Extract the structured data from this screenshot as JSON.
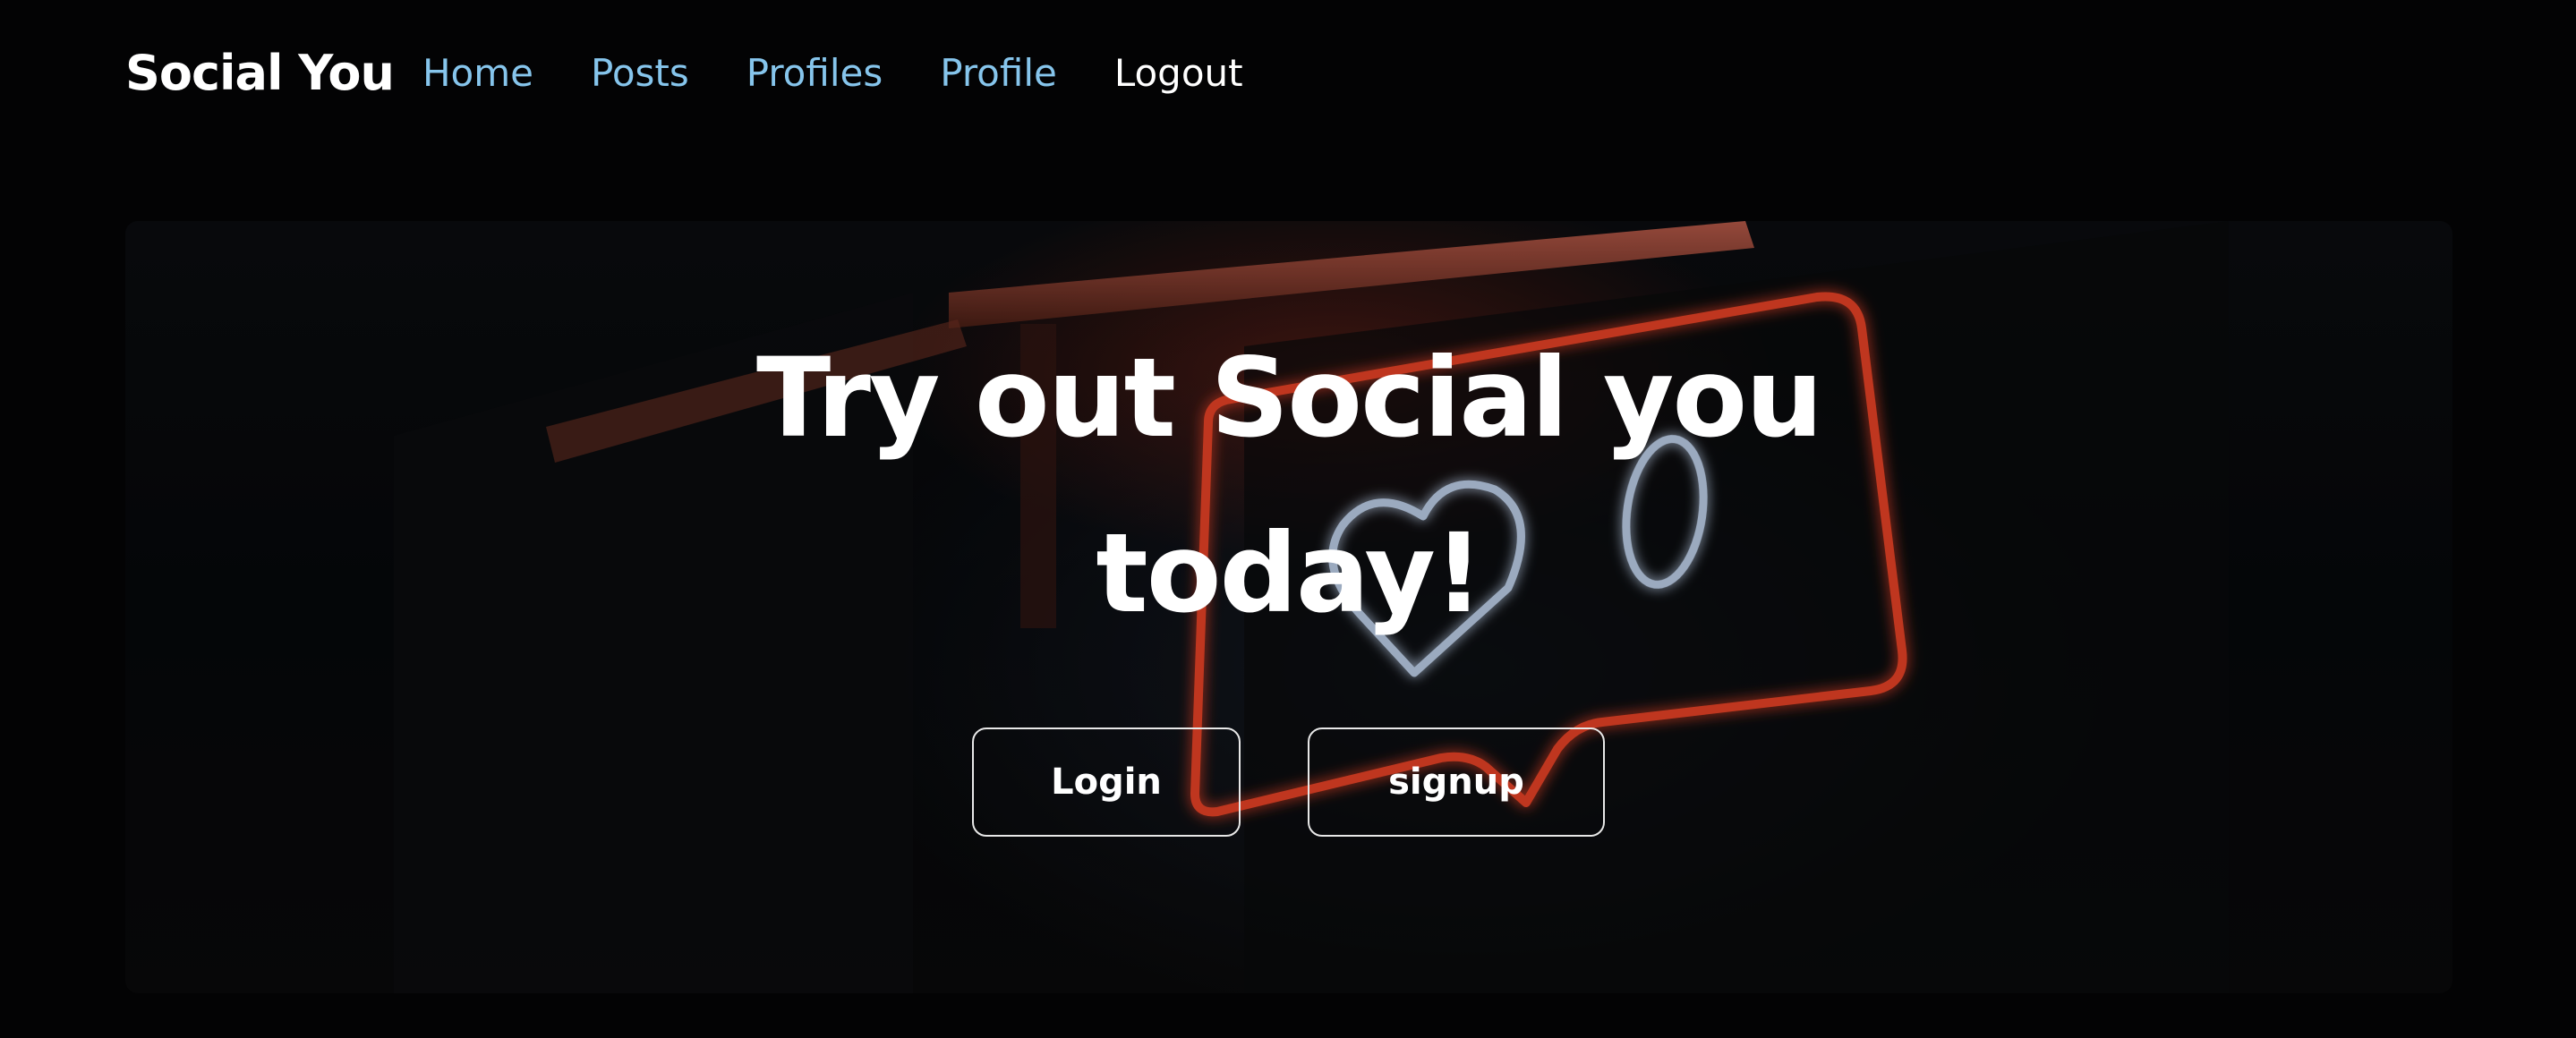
{
  "nav": {
    "brand": "Social You",
    "links": [
      {
        "label": "Home"
      },
      {
        "label": "Posts"
      },
      {
        "label": "Profiles"
      },
      {
        "label": "Profile"
      },
      {
        "label": "Logout"
      }
    ]
  },
  "hero": {
    "title_line1": "Try out Social you",
    "title_line2": "today!",
    "login_label": "Login",
    "signup_label": "signup"
  },
  "colors": {
    "background": "#030304",
    "nav_link": "#86c5ec",
    "text": "#ffffff",
    "neon_red": "#ff4a2a",
    "neon_blue": "#cfe3ff"
  },
  "icons": [
    "neon-heart-sign"
  ]
}
